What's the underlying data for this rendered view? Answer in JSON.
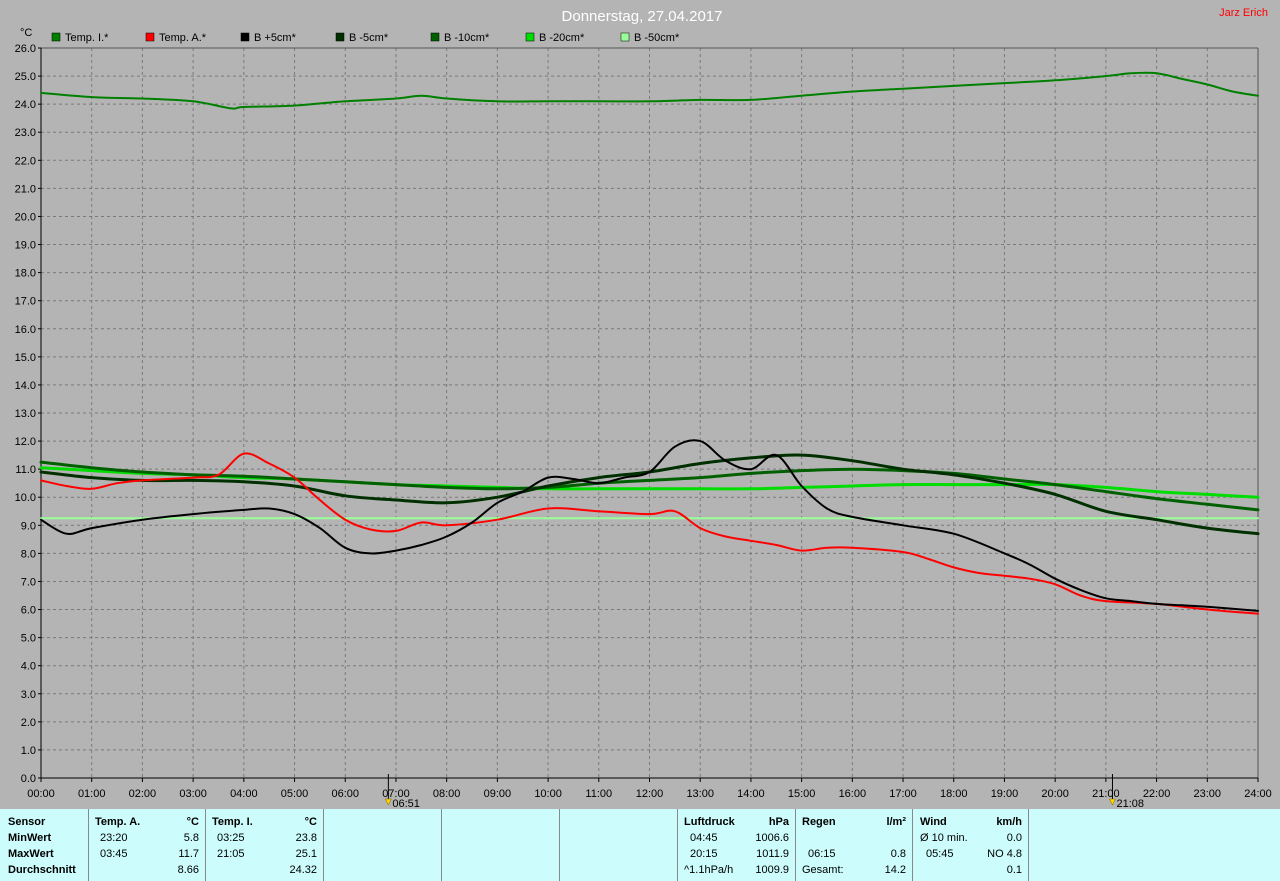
{
  "chart_data": {
    "type": "line",
    "title": "Donnerstag, 27.04.2017",
    "author": "Jarz Erich",
    "ylabel": "°C",
    "ylim": [
      0,
      26
    ],
    "xlim": [
      0,
      24
    ],
    "grid": true,
    "legend_position": "top",
    "y_ticks": [
      "0.0",
      "1.0",
      "2.0",
      "3.0",
      "4.0",
      "5.0",
      "6.0",
      "7.0",
      "8.0",
      "9.0",
      "10.0",
      "11.0",
      "12.0",
      "13.0",
      "14.0",
      "15.0",
      "16.0",
      "17.0",
      "18.0",
      "19.0",
      "20.0",
      "21.0",
      "22.0",
      "23.0",
      "24.0",
      "25.0",
      "26.0"
    ],
    "x_ticks": [
      "00:00",
      "01:00",
      "02:00",
      "03:00",
      "04:00",
      "05:00",
      "06:00",
      "07:00",
      "08:00",
      "09:00",
      "10:00",
      "11:00",
      "12:00",
      "13:00",
      "14:00",
      "15:00",
      "16:00",
      "17:00",
      "18:00",
      "19:00",
      "20:00",
      "21:00",
      "22:00",
      "23:00",
      "24:00"
    ],
    "markers": [
      {
        "label": "06:51",
        "x": 6.85
      },
      {
        "label": "21:08",
        "x": 21.13
      }
    ],
    "series": [
      {
        "name": "Temp. I.*",
        "color": "#008000",
        "width": 2,
        "x": [
          0,
          1,
          2,
          3,
          3.75,
          4,
          5,
          6,
          7,
          7.5,
          8,
          9,
          10,
          11,
          12,
          13,
          14,
          15,
          16,
          17,
          18,
          19,
          20,
          21,
          21.5,
          22,
          22.5,
          23,
          23.5,
          24
        ],
        "y": [
          24.4,
          24.25,
          24.2,
          24.1,
          23.85,
          23.9,
          23.95,
          24.1,
          24.2,
          24.3,
          24.2,
          24.1,
          24.1,
          24.1,
          24.1,
          24.15,
          24.15,
          24.3,
          24.45,
          24.55,
          24.65,
          24.75,
          24.85,
          25.0,
          25.1,
          25.1,
          24.9,
          24.7,
          24.45,
          24.3
        ]
      },
      {
        "name": "Temp. A.*",
        "color": "#ff0000",
        "width": 2,
        "x": [
          0,
          0.5,
          1,
          1.5,
          2,
          3,
          3.5,
          4,
          4.5,
          5,
          5.5,
          6,
          6.5,
          7,
          7.5,
          8,
          9,
          10,
          11,
          12,
          12.5,
          13,
          13.5,
          14,
          14.5,
          15,
          15.5,
          16,
          17,
          17.5,
          18,
          18.5,
          19,
          19.5,
          20,
          20.5,
          21,
          22,
          23,
          24
        ],
        "y": [
          10.6,
          10.4,
          10.3,
          10.5,
          10.6,
          10.7,
          10.8,
          11.55,
          11.2,
          10.7,
          9.9,
          9.2,
          8.85,
          8.8,
          9.1,
          9.0,
          9.2,
          9.6,
          9.5,
          9.4,
          9.5,
          8.9,
          8.6,
          8.45,
          8.3,
          8.1,
          8.2,
          8.2,
          8.05,
          7.8,
          7.5,
          7.3,
          7.2,
          7.1,
          6.9,
          6.5,
          6.3,
          6.2,
          6.0,
          5.85
        ]
      },
      {
        "name": "B +5cm*",
        "color": "#000000",
        "width": 2,
        "x": [
          0,
          0.5,
          1,
          2,
          3,
          4,
          4.5,
          5,
          5.5,
          6,
          6.5,
          7,
          7.5,
          8,
          8.5,
          9,
          9.5,
          10,
          10.5,
          11,
          11.5,
          12,
          12.5,
          13,
          13.5,
          14,
          14.5,
          15,
          15.5,
          16,
          17,
          18,
          19,
          19.5,
          20,
          20.5,
          21,
          21.5,
          22,
          22.5,
          23,
          24
        ],
        "y": [
          9.2,
          8.7,
          8.9,
          9.2,
          9.4,
          9.55,
          9.6,
          9.4,
          8.9,
          8.2,
          8.0,
          8.1,
          8.3,
          8.6,
          9.1,
          9.8,
          10.2,
          10.7,
          10.65,
          10.5,
          10.7,
          10.9,
          11.8,
          12.0,
          11.3,
          11.0,
          11.5,
          10.4,
          9.6,
          9.3,
          9.0,
          8.7,
          8.0,
          7.6,
          7.1,
          6.7,
          6.4,
          6.3,
          6.2,
          6.15,
          6.1,
          5.95
        ]
      },
      {
        "name": "B -5cm*",
        "color": "#003000",
        "width": 3,
        "x": [
          0,
          1,
          2,
          3,
          4,
          5,
          6,
          7,
          8,
          9,
          10,
          11,
          12,
          13,
          14,
          15,
          16,
          17,
          18,
          19,
          20,
          21,
          22,
          23,
          24
        ],
        "y": [
          10.9,
          10.7,
          10.6,
          10.6,
          10.55,
          10.4,
          10.05,
          9.9,
          9.8,
          10.0,
          10.4,
          10.7,
          10.9,
          11.2,
          11.4,
          11.5,
          11.3,
          11.0,
          10.8,
          10.5,
          10.1,
          9.5,
          9.2,
          8.9,
          8.7
        ]
      },
      {
        "name": "B -10cm*",
        "color": "#006000",
        "width": 3,
        "x": [
          0,
          1,
          2,
          3,
          4,
          5,
          6,
          7,
          8,
          9,
          10,
          11,
          12,
          13,
          14,
          15,
          16,
          17,
          18,
          19,
          20,
          21,
          22,
          23,
          24
        ],
        "y": [
          11.25,
          11.05,
          10.9,
          10.8,
          10.75,
          10.65,
          10.55,
          10.45,
          10.35,
          10.3,
          10.35,
          10.5,
          10.6,
          10.7,
          10.85,
          10.95,
          11.0,
          10.95,
          10.85,
          10.65,
          10.45,
          10.2,
          9.95,
          9.75,
          9.55
        ]
      },
      {
        "name": "B -20cm*",
        "color": "#00dd00",
        "width": 3,
        "x": [
          0,
          1,
          2,
          3,
          4,
          5,
          6,
          7,
          8,
          9,
          10,
          11,
          12,
          13,
          14,
          15,
          16,
          17,
          18,
          19,
          20,
          21,
          22,
          23,
          24
        ],
        "y": [
          11.05,
          10.95,
          10.85,
          10.8,
          10.7,
          10.65,
          10.55,
          10.45,
          10.4,
          10.35,
          10.3,
          10.3,
          10.3,
          10.3,
          10.3,
          10.35,
          10.4,
          10.45,
          10.45,
          10.45,
          10.45,
          10.35,
          10.2,
          10.1,
          10.0
        ]
      },
      {
        "name": "B -50cm*",
        "color": "#99ff99",
        "width": 2,
        "x": [
          0,
          24
        ],
        "y": [
          9.25,
          9.25
        ]
      }
    ]
  },
  "stats": {
    "sensor": {
      "header": "Sensor",
      "min": "MinWert",
      "max": "MaxWert",
      "avg": "Durchschnitt"
    },
    "temp_a": {
      "header": "Temp. A.",
      "unit": "°C",
      "min_time": "23:20",
      "min_val": "5.8",
      "max_time": "03:45",
      "max_val": "11.7",
      "avg": "8.66"
    },
    "temp_i": {
      "header": "Temp. I.",
      "unit": "°C",
      "min_time": "03:25",
      "min_val": "23.8",
      "max_time": "21:05",
      "max_val": "25.1",
      "avg": "24.32"
    },
    "pressure": {
      "header": "Luftdruck",
      "unit": "hPa",
      "min_time": "04:45",
      "min_val": "1006.6",
      "max_time": "20:15",
      "max_val": "1011.9",
      "trend": "^1.1hPa/h",
      "current": "1009.9"
    },
    "rain": {
      "header": "Regen",
      "unit": "l/m²",
      "time": "06:15",
      "val": "0.8",
      "total_label": "Gesamt:",
      "total": "14.2"
    },
    "wind": {
      "header": "Wind",
      "unit": "km/h",
      "avg_label": "Ø 10 min.",
      "avg_val": "0.0",
      "max_time": "05:45",
      "max_val": "NO 4.8",
      "current": "0.1"
    }
  }
}
